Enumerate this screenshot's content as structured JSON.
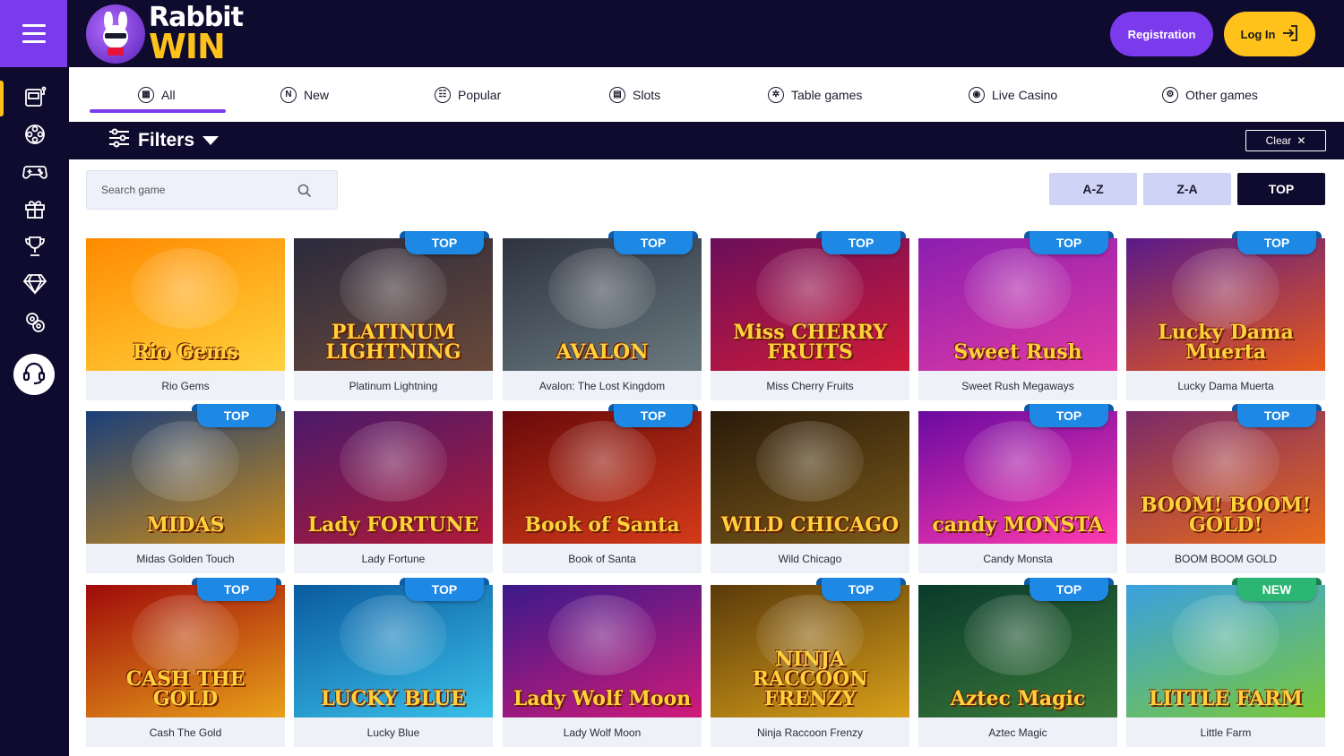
{
  "header": {
    "logo_line1": "Rabbit",
    "logo_line2": "WIN",
    "registration_label": "Registration",
    "login_label": "Log In"
  },
  "sidebar": {
    "items": [
      {
        "icon": "slot-machine-icon"
      },
      {
        "icon": "film-reel-icon"
      },
      {
        "icon": "gamepad-icon"
      },
      {
        "icon": "gift-icon"
      },
      {
        "icon": "trophy-icon"
      },
      {
        "icon": "diamond-icon"
      },
      {
        "icon": "chips-icon"
      }
    ],
    "support_icon": "headset-icon"
  },
  "categories": [
    {
      "label": "All",
      "icon": "grid-icon",
      "glyph": "▦"
    },
    {
      "label": "New",
      "icon": "new-icon",
      "glyph": "N"
    },
    {
      "label": "Popular",
      "icon": "popular-icon",
      "glyph": "☷"
    },
    {
      "label": "Slots",
      "icon": "slots-icon",
      "glyph": "▤"
    },
    {
      "label": "Table games",
      "icon": "table-games-icon",
      "glyph": "✲"
    },
    {
      "label": "Live Casino",
      "icon": "live-casino-icon",
      "glyph": "◉"
    },
    {
      "label": "Other games",
      "icon": "other-games-icon",
      "glyph": "⚙"
    }
  ],
  "filters": {
    "label": "Filters",
    "clear_label": "Clear"
  },
  "search": {
    "placeholder": "Search game"
  },
  "sort": {
    "options": [
      "A-Z",
      "Z-A",
      "TOP"
    ],
    "active": "TOP"
  },
  "games": [
    {
      "name": "Rio Gems",
      "title": "Rio Gems",
      "badge": "",
      "c1": "#ff8a00",
      "c2": "#ffd23d"
    },
    {
      "name": "Platinum Lightning",
      "title": "PLATINUM LIGHTNING",
      "badge": "TOP",
      "c1": "#2b2a3d",
      "c2": "#6a4a3a"
    },
    {
      "name": "Avalon: The Lost Kingdom",
      "title": "AVALON",
      "badge": "TOP",
      "c1": "#2d3340",
      "c2": "#6b7a80"
    },
    {
      "name": "Miss Cherry Fruits",
      "title": "Miss CHERRY FRUITS",
      "badge": "TOP",
      "c1": "#6a0f5a",
      "c2": "#d11a3a"
    },
    {
      "name": "Sweet Rush Megaways",
      "title": "Sweet Rush",
      "badge": "TOP",
      "c1": "#8a1fb0",
      "c2": "#e23aa5"
    },
    {
      "name": "Lucky Dama Muerta",
      "title": "Lucky Dama Muerta",
      "badge": "TOP",
      "c1": "#5a1a8a",
      "c2": "#e85a1a"
    },
    {
      "name": "Midas Golden Touch",
      "title": "MIDAS",
      "badge": "TOP",
      "c1": "#1a3f7a",
      "c2": "#c98a1a"
    },
    {
      "name": "Lady Fortune",
      "title": "Lady FORTUNE",
      "badge": "",
      "c1": "#4a1a6a",
      "c2": "#b01a3a"
    },
    {
      "name": "Book of Santa",
      "title": "Book of Santa",
      "badge": "TOP",
      "c1": "#6a0a0a",
      "c2": "#d43a1a"
    },
    {
      "name": "Wild Chicago",
      "title": "WILD CHICAGO",
      "badge": "",
      "c1": "#2a1a0a",
      "c2": "#7a5a1a"
    },
    {
      "name": "Candy Monsta",
      "title": "candy MONSTA",
      "badge": "TOP",
      "c1": "#6a0aa0",
      "c2": "#ff3ab0"
    },
    {
      "name": "BOOM BOOM GOLD",
      "title": "BOOM! BOOM! GOLD!",
      "badge": "TOP",
      "c1": "#7a2a6a",
      "c2": "#e86a1a"
    },
    {
      "name": "Cash The Gold",
      "title": "CASH THE GOLD",
      "badge": "TOP",
      "c1": "#a00a0a",
      "c2": "#e8a01a"
    },
    {
      "name": "Lucky Blue",
      "title": "LUCKY BLUE",
      "badge": "TOP",
      "c1": "#0a5aa0",
      "c2": "#3ac0e8"
    },
    {
      "name": "Lady Wolf Moon",
      "title": "Lady Wolf Moon",
      "badge": "",
      "c1": "#3a1a8a",
      "c2": "#d01a7a"
    },
    {
      "name": "Ninja Raccoon Frenzy",
      "title": "NINJA RACCOON FRENZY",
      "badge": "TOP",
      "c1": "#5a3a0a",
      "c2": "#d8a01a"
    },
    {
      "name": "Aztec Magic",
      "title": "Aztec Magic",
      "badge": "TOP",
      "c1": "#0a3a2a",
      "c2": "#3a7a3a"
    },
    {
      "name": "Little Farm",
      "title": "LITTLE FARM",
      "badge": "NEW",
      "c1": "#3aa0e0",
      "c2": "#7ac83a"
    }
  ]
}
